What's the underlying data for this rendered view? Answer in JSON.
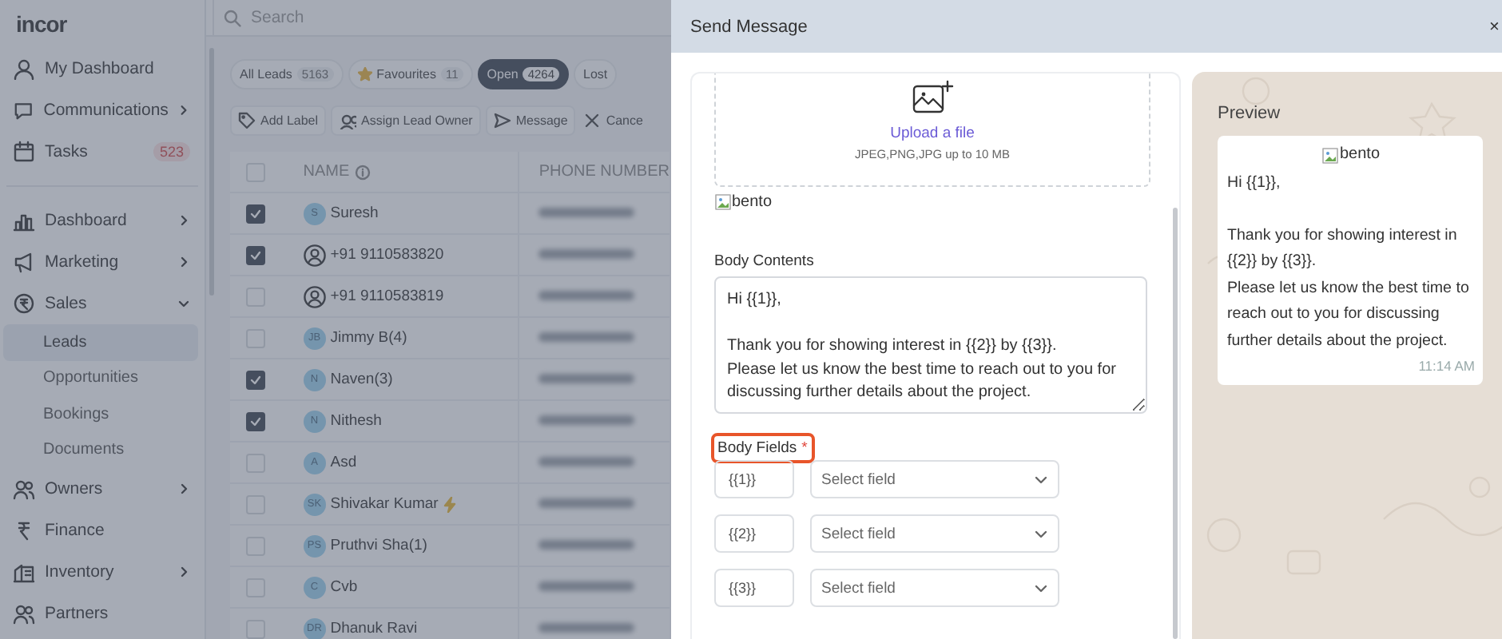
{
  "app": {
    "logo": "incor",
    "search": {
      "placeholder": "Search"
    },
    "sidebar": {
      "items": [
        {
          "label": "My Dashboard"
        },
        {
          "label": "Communications",
          "expanded": false
        },
        {
          "label": "Tasks",
          "badge": "523"
        },
        {
          "label": "Dashboard",
          "expanded": false
        },
        {
          "label": "Marketing",
          "expanded": false
        },
        {
          "label": "Sales",
          "expanded": true,
          "children": [
            {
              "label": "Leads",
              "selected": true
            },
            {
              "label": "Opportunities",
              "selected": false
            },
            {
              "label": "Bookings",
              "selected": false
            },
            {
              "label": "Documents",
              "selected": false
            }
          ]
        },
        {
          "label": "Owners",
          "expanded": false
        },
        {
          "label": "Finance"
        },
        {
          "label": "Inventory",
          "expanded": false
        },
        {
          "label": "Partners"
        }
      ]
    },
    "filters": [
      {
        "label": "All Leads",
        "count": "5163",
        "selected": false
      },
      {
        "label": "Favourites",
        "count": "11",
        "selected": false,
        "kind": "starred"
      },
      {
        "label": "Open",
        "count": "4264",
        "selected": true
      },
      {
        "label": "Lost",
        "selected": false
      }
    ],
    "actions": [
      {
        "label": "Add Label",
        "kind": "tag"
      },
      {
        "label": "Assign Lead Owner",
        "kind": "people"
      },
      {
        "label": "Message",
        "kind": "send"
      },
      {
        "label": "Cance",
        "kind": "cancel"
      }
    ],
    "table": {
      "all_checked": false,
      "columns": [
        "NAME",
        "PHONE NUMBER"
      ],
      "rows": [
        {
          "checked": true,
          "avatar": "S",
          "name": "Suresh",
          "hot": false
        },
        {
          "checked": true,
          "name": "+91 9110583820",
          "hot": false
        },
        {
          "checked": false,
          "name": "+91 9110583819",
          "hot": false
        },
        {
          "checked": false,
          "avatar": "JB",
          "name": "Jimmy B(4)",
          "hot": false
        },
        {
          "checked": true,
          "avatar": "N",
          "name": "Naven(3)",
          "hot": false
        },
        {
          "checked": true,
          "avatar": "N",
          "name": "Nithesh",
          "hot": false
        },
        {
          "checked": false,
          "avatar": "A",
          "name": "Asd",
          "hot": false
        },
        {
          "checked": false,
          "avatar": "SK",
          "name": "Shivakar Kumar",
          "hot": true
        },
        {
          "checked": false,
          "avatar": "PS",
          "name": "Pruthvi Sha(1)",
          "hot": false
        },
        {
          "checked": false,
          "avatar": "C",
          "name": "Cvb",
          "hot": false
        },
        {
          "checked": false,
          "avatar": "DR",
          "name": "Dhanuk Ravi",
          "hot": false
        }
      ]
    }
  },
  "drawer": {
    "title": "Send Message",
    "close": "×",
    "upload": {
      "link": "Upload a file",
      "hint": "JPEG,PNG,JPG up to 10 MB"
    },
    "image_alt": "bento",
    "body": {
      "label": "Body Contents",
      "value": "Hi {{1}},\n\nThank you for showing interest in {{2}} by {{3}}.\nPlease let us know the best time to reach out to you for discussing further details about the project."
    },
    "body_fields": {
      "label": "Body Fields",
      "required_mark": "*",
      "highlighted": true,
      "rows": [
        {
          "token": "{{1}}",
          "placeholder": "Select field"
        },
        {
          "token": "{{2}}",
          "placeholder": "Select field"
        },
        {
          "token": "{{3}}",
          "placeholder": "Select field"
        }
      ]
    },
    "preview": {
      "title": "Preview",
      "image_alt": "bento",
      "text": "Hi {{1}},\n\nThank you for showing interest in {{2}} by {{3}}.\nPlease let us know the best time to reach out to you for discussing further details about the project.",
      "time": "11:14 AM"
    }
  }
}
